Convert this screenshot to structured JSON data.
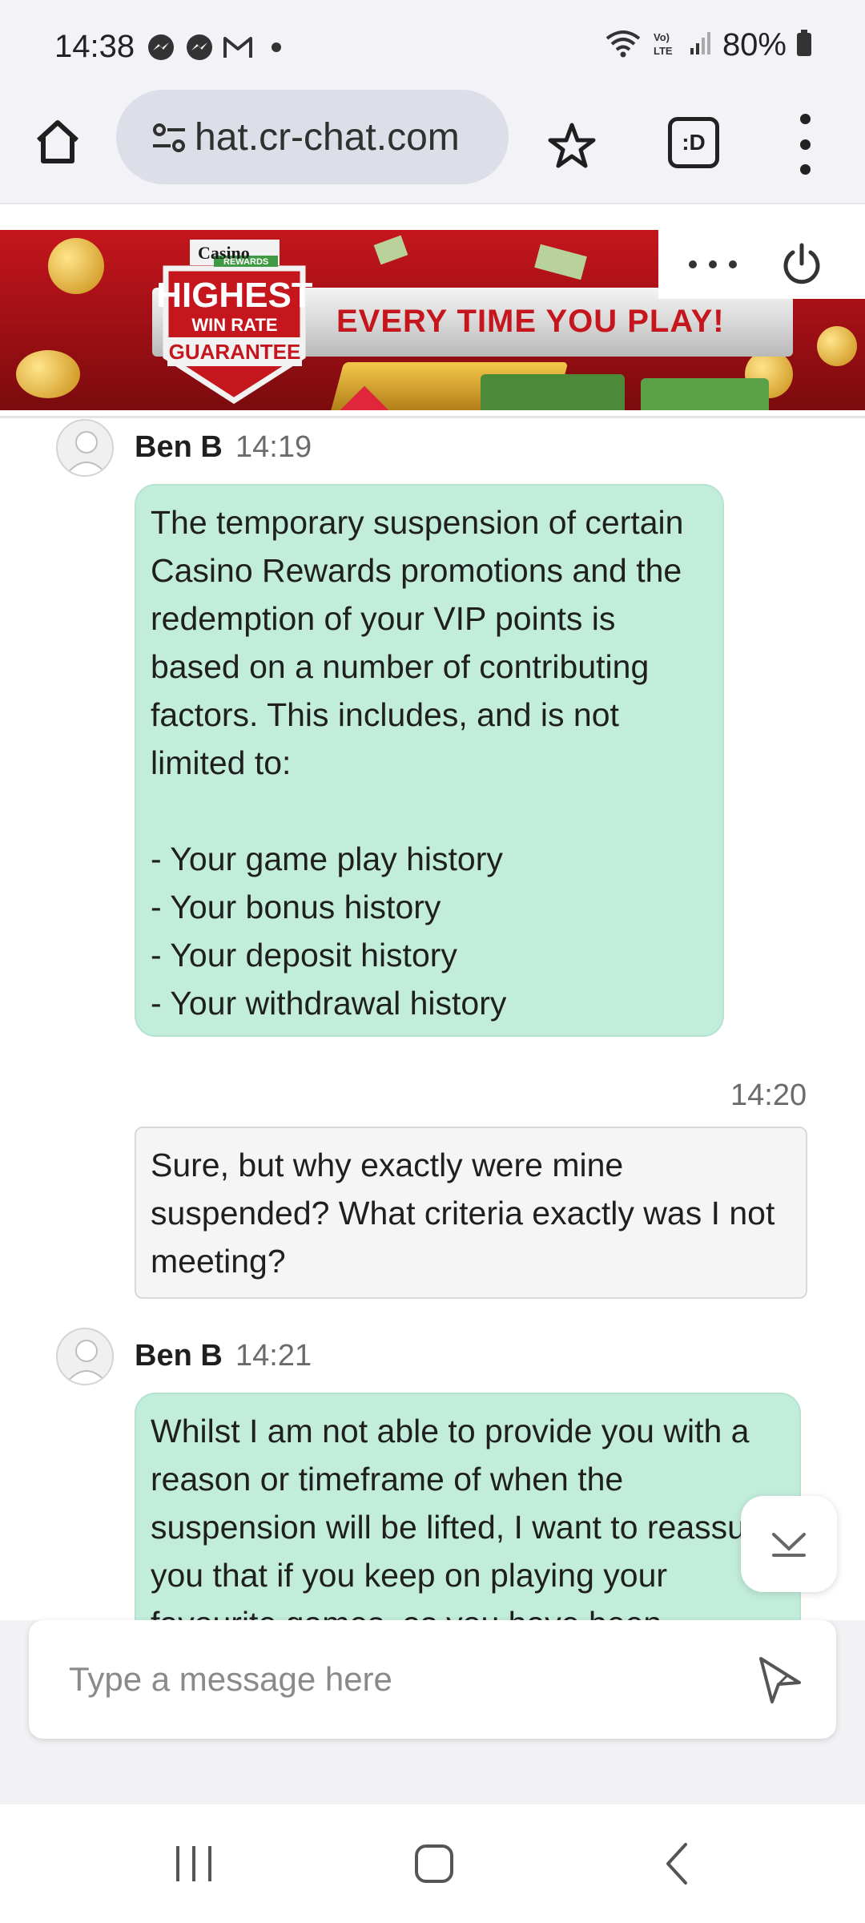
{
  "status_bar": {
    "time": "14:38",
    "notification_icons": [
      "messenger-icon",
      "messenger-icon",
      "gmail-icon",
      "dot-icon"
    ],
    "battery": "80%"
  },
  "browser": {
    "url": "hat.cr-chat.com",
    "tabs_label": ":D"
  },
  "banner": {
    "brand_small": "Casino",
    "brand_rewards": "REWARDS",
    "badge_line1": "HIGHEST",
    "badge_line2": "WIN RATE",
    "badge_line3": "GUARANTEE",
    "tagline": "EVERY TIME YOU PLAY!"
  },
  "messages": [
    {
      "sender": "Ben B",
      "time": "14:19",
      "text": "The temporary suspension of certain Casino Rewards promotions and the redemption of your VIP points is based on a number of contributing factors. This includes, and is not limited to:\n\n- Your game play history\n- Your bonus history\n- Your deposit history\n- Your withdrawal history"
    },
    {
      "sender": "",
      "time": "14:20",
      "text": "Sure, but why exactly were mine suspended? What criteria exactly was I not meeting?"
    },
    {
      "sender": "Ben B",
      "time": "14:21",
      "text": "Whilst I am not able to provide you with a reason or timeframe of when the suspension will be lifted, I want to reassure you that if you keep on playing your favourite games, as you have been"
    }
  ],
  "composer": {
    "placeholder": "Type a message here"
  },
  "colors": {
    "agent_bubble": "#c2eddb",
    "user_bubble": "#f5f5f5",
    "banner_red": "#c4161c"
  }
}
